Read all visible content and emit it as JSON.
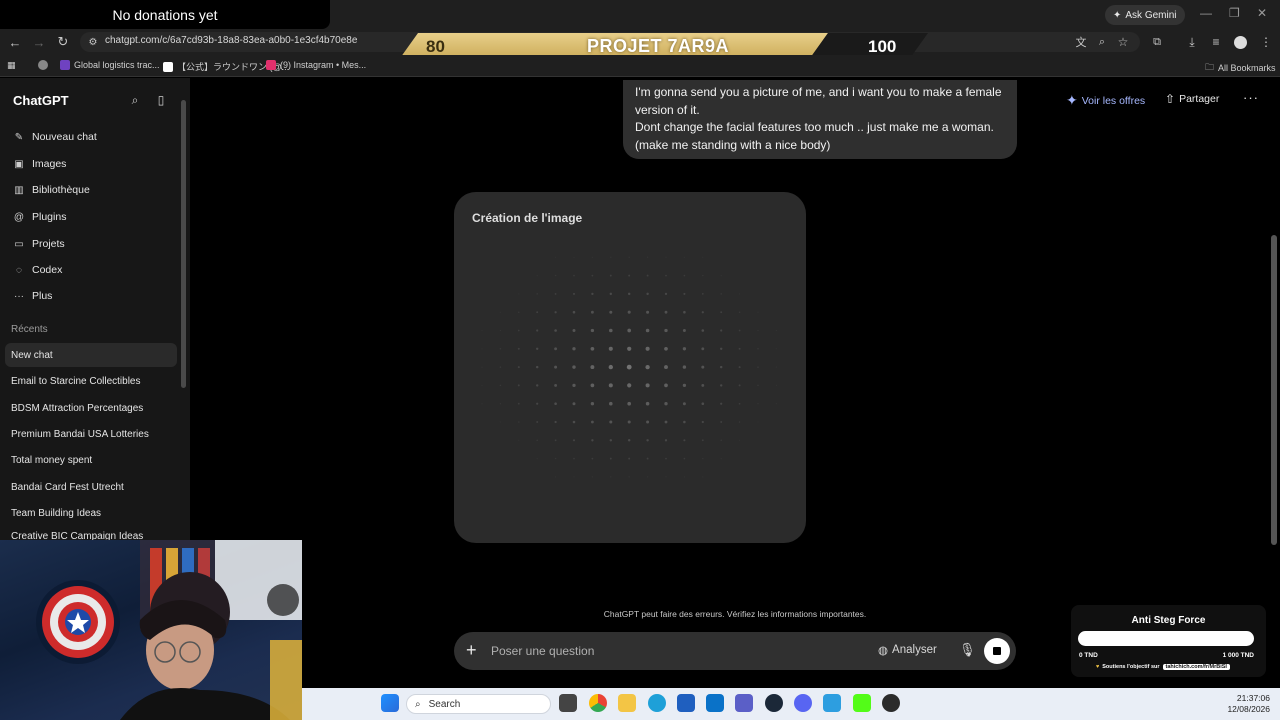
{
  "stream": {
    "donations": "No donations yet",
    "banner": {
      "left": "80",
      "title": "PROJET 7AR9A",
      "right": "100"
    },
    "goal": {
      "title": "Anti Steg Force",
      "min": "0 TND",
      "max": "1 000 TND",
      "support_text": "Soutiens l'objectif sur",
      "support_link": "tahichich.com/fr/MrBiSI",
      "progress": 0
    }
  },
  "browser": {
    "ask_gemini": "Ask Gemini",
    "url": "chatgpt.com/c/6a7cd93b-18a8-83ea-a0b0-1e3cf4b70e8e",
    "bookmarks": [
      {
        "label": "Global logistics trac...",
        "color": "#6f42c1"
      },
      {
        "label": "【公式】ラウンドワン (@...",
        "color": "#ffffff"
      },
      {
        "label": "(9) Instagram • Mes...",
        "color": "#e1306c"
      }
    ],
    "all_bookmarks": "All Bookmarks"
  },
  "sidebar": {
    "title": "ChatGPT",
    "items": [
      {
        "label": "Nouveau chat",
        "icon": "compose-icon"
      },
      {
        "label": "Images",
        "icon": "images-icon"
      },
      {
        "label": "Bibliothèque",
        "icon": "library-icon"
      },
      {
        "label": "Plugins",
        "icon": "at-icon"
      },
      {
        "label": "Projets",
        "icon": "folder-icon"
      },
      {
        "label": "Codex",
        "icon": "codex-icon"
      },
      {
        "label": "Plus",
        "icon": "more-icon"
      }
    ],
    "recents_label": "Récents",
    "recents": [
      "New chat",
      "Email to Starcine Collectibles",
      "BDSM Attraction Percentages",
      "Premium Bandai USA Lotteries",
      "Total money spent",
      "Bandai Card Fest Utrecht",
      "Team Building Ideas",
      "Creative BIC Campaign Ideas"
    ]
  },
  "header": {
    "offers": "Voir les offres",
    "share": "Partager"
  },
  "chat": {
    "user_message_lines": [
      "I'm gonna send you a picture of me, and i want you to make a female",
      "version of it.",
      "Dont change the facial features too much .. just make me a woman.",
      "(make me standing with a nice body)"
    ],
    "image_card_label": "Création de l'image"
  },
  "composer": {
    "placeholder": "Poser une question",
    "analyser": "Analyser",
    "disclaimer": "ChatGPT peut faire des erreurs. Vérifiez les informations importantes."
  },
  "taskbar": {
    "search": "Search",
    "time": "21:37:06",
    "date": "12/08/2026"
  }
}
